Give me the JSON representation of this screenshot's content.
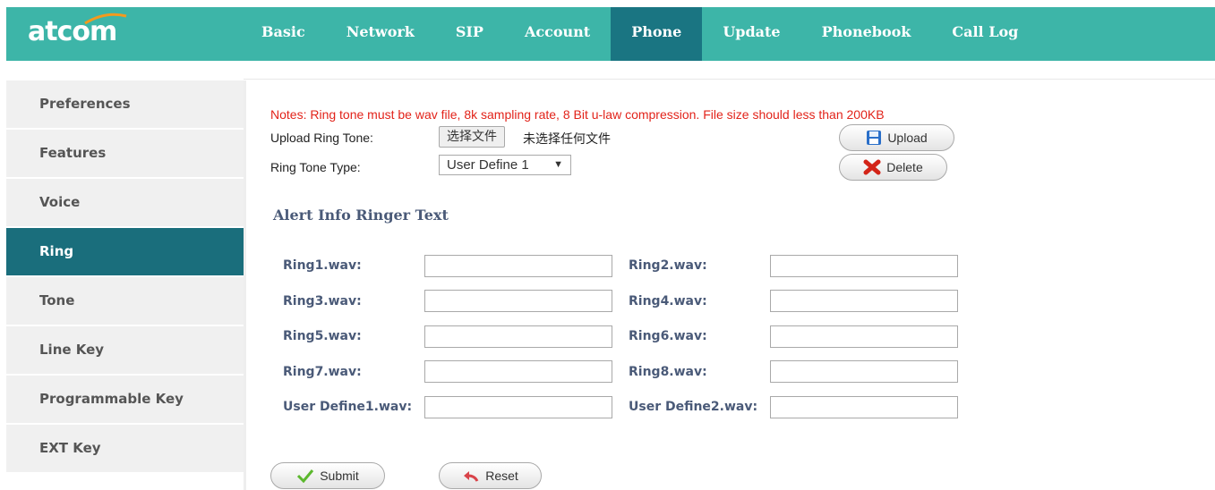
{
  "header": {
    "logo": "atcom",
    "tabs": [
      {
        "label": "Basic"
      },
      {
        "label": "Network"
      },
      {
        "label": "SIP"
      },
      {
        "label": "Account"
      },
      {
        "label": "Phone",
        "active": true
      },
      {
        "label": "Update"
      },
      {
        "label": "Phonebook"
      },
      {
        "label": "Call Log"
      }
    ]
  },
  "sidebar": {
    "items": [
      {
        "label": "Preferences"
      },
      {
        "label": "Features"
      },
      {
        "label": "Voice"
      },
      {
        "label": "Ring",
        "active": true
      },
      {
        "label": "Tone"
      },
      {
        "label": "Line Key"
      },
      {
        "label": "Programmable Key"
      },
      {
        "label": "EXT Key"
      }
    ]
  },
  "main": {
    "notes": "Notes: Ring tone must be wav file, 8k sampling rate, 8 Bit u-law compression. File size should less than 200KB",
    "upload_label": "Upload Ring Tone:",
    "file_button": "选择文件",
    "file_status": "未选择任何文件",
    "type_label": "Ring Tone Type:",
    "type_value": "User Define 1",
    "upload_button": "Upload",
    "delete_button": "Delete",
    "section_title": "Alert Info Ringer Text",
    "rings": [
      {
        "label": "Ring1.wav:",
        "value": ""
      },
      {
        "label": "Ring2.wav:",
        "value": ""
      },
      {
        "label": "Ring3.wav:",
        "value": ""
      },
      {
        "label": "Ring4.wav:",
        "value": ""
      },
      {
        "label": "Ring5.wav:",
        "value": ""
      },
      {
        "label": "Ring6.wav:",
        "value": ""
      },
      {
        "label": "Ring7.wav:",
        "value": ""
      },
      {
        "label": "Ring8.wav:",
        "value": ""
      },
      {
        "label": "User Define1.wav:",
        "value": ""
      },
      {
        "label": "User Define2.wav:",
        "value": ""
      }
    ],
    "submit_button": "Submit",
    "reset_button": "Reset"
  },
  "colors": {
    "header_bg": "#3db5a8",
    "active_tab": "#1a7582",
    "active_side": "#1a6e7c",
    "notes_text": "#e2231a",
    "label_text": "#4a5a78"
  },
  "icons": {
    "upload": "floppy-disk-icon",
    "delete": "red-x-icon",
    "submit": "green-check-icon",
    "reset": "undo-arrow-icon"
  }
}
